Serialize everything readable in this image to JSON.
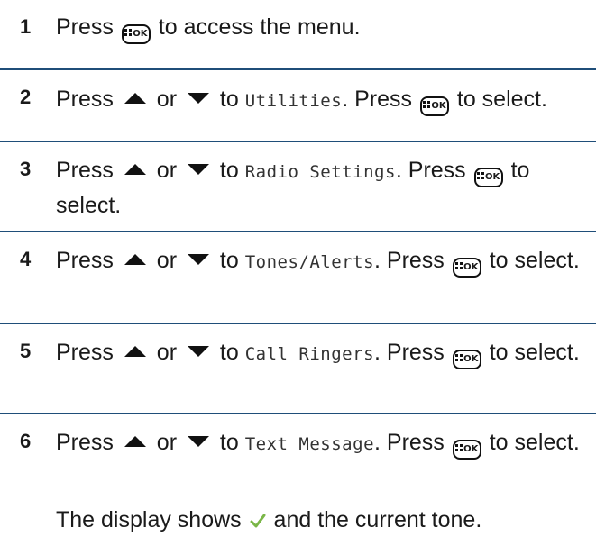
{
  "steps": [
    {
      "number": "1",
      "parts": [
        {
          "t": "text",
          "v": "Press "
        },
        {
          "t": "ok"
        },
        {
          "t": "text",
          "v": " to access the menu."
        }
      ]
    },
    {
      "number": "2",
      "parts": [
        {
          "t": "text",
          "v": "Press "
        },
        {
          "t": "up"
        },
        {
          "t": "text",
          "v": " or "
        },
        {
          "t": "down"
        },
        {
          "t": "text",
          "v": " to "
        },
        {
          "t": "mono",
          "v": "Utilities"
        },
        {
          "t": "text",
          "v": ". Press "
        },
        {
          "t": "ok"
        },
        {
          "t": "text",
          "v": " to select."
        }
      ]
    },
    {
      "number": "3",
      "parts": [
        {
          "t": "text",
          "v": "Press "
        },
        {
          "t": "up"
        },
        {
          "t": "text",
          "v": " or "
        },
        {
          "t": "down"
        },
        {
          "t": "text",
          "v": " to "
        },
        {
          "t": "mono",
          "v": "Radio Settings"
        },
        {
          "t": "text",
          "v": ". Press "
        },
        {
          "t": "ok"
        },
        {
          "t": "text",
          "v": " to select."
        }
      ]
    },
    {
      "number": "4",
      "parts": [
        {
          "t": "text",
          "v": "Press "
        },
        {
          "t": "up"
        },
        {
          "t": "text",
          "v": " or "
        },
        {
          "t": "down"
        },
        {
          "t": "text",
          "v": " to "
        },
        {
          "t": "mono",
          "v": "Tones/Alerts"
        },
        {
          "t": "text",
          "v": ". Press "
        },
        {
          "t": "ok"
        },
        {
          "t": "text",
          "v": " to select."
        }
      ]
    },
    {
      "number": "5",
      "parts": [
        {
          "t": "text",
          "v": "Press "
        },
        {
          "t": "up"
        },
        {
          "t": "text",
          "v": " or "
        },
        {
          "t": "down"
        },
        {
          "t": "text",
          "v": " to "
        },
        {
          "t": "mono",
          "v": "Call Ringers"
        },
        {
          "t": "text",
          "v": ". Press "
        },
        {
          "t": "ok"
        },
        {
          "t": "text",
          "v": " to select."
        }
      ]
    },
    {
      "number": "6",
      "parts": [
        {
          "t": "text",
          "v": "Press "
        },
        {
          "t": "up"
        },
        {
          "t": "text",
          "v": " or "
        },
        {
          "t": "down"
        },
        {
          "t": "text",
          "v": " to "
        },
        {
          "t": "mono",
          "v": "Text Message"
        },
        {
          "t": "text",
          "v": ". Press "
        },
        {
          "t": "ok"
        },
        {
          "t": "text",
          "v": " to select."
        }
      ],
      "result": [
        {
          "t": "text",
          "v": "The display shows "
        },
        {
          "t": "check"
        },
        {
          "t": "text",
          "v": " and the current tone."
        }
      ]
    }
  ],
  "ok_button": {
    "label": "OK"
  },
  "icons": {
    "ok": "menu-ok-button-icon",
    "up": "up-arrow-icon",
    "down": "down-arrow-icon",
    "check": "checkmark-icon"
  },
  "colors": {
    "divider": "#1f4e79",
    "check": "#7ab648",
    "text": "#1a1a1a"
  }
}
